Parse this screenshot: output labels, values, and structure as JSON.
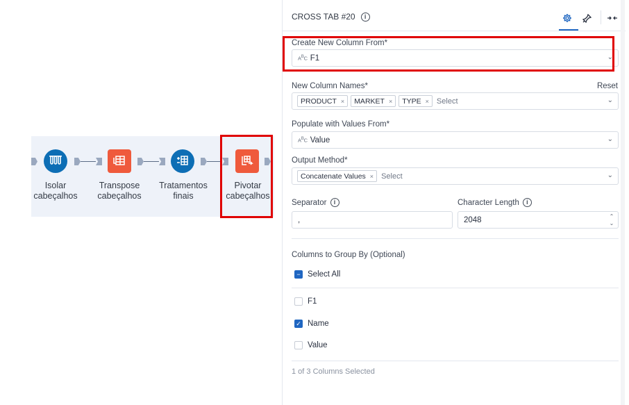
{
  "workflow": {
    "nodes": [
      {
        "label": "Isolar\ncabeçalhos",
        "icon": "test-tubes-icon",
        "shape": "circle",
        "color": "#0d6eb5"
      },
      {
        "label": "Transpose\ncabeçalhos",
        "icon": "transpose-icon",
        "shape": "square",
        "color": "#ef5a3c"
      },
      {
        "label": "Tratamentos\nfinais",
        "icon": "formula-icon",
        "shape": "circle",
        "color": "#0d6eb5"
      },
      {
        "label": "Pivotar\ncabeçalhos",
        "icon": "cross-tab-icon",
        "shape": "square",
        "color": "#ef5a3c"
      }
    ]
  },
  "panel": {
    "title": "CROSS TAB #20",
    "info_icon": "info-icon",
    "tabs": {
      "configuration": "gear-icon",
      "annotation": "pin-icon",
      "collapse": "collapse-panel-icon"
    }
  },
  "form": {
    "create_new_column": {
      "label": "Create New Column From*",
      "type_icon": "string-type-icon",
      "value": "F1"
    },
    "new_column_names": {
      "label": "New Column Names*",
      "reset": "Reset",
      "chips": [
        "PRODUCT",
        "MARKET",
        "TYPE"
      ],
      "placeholder": "Select"
    },
    "populate_values": {
      "label": "Populate with Values From*",
      "type_icon": "string-type-icon",
      "value": "Value"
    },
    "output_method": {
      "label": "Output Method*",
      "chips": [
        "Concatenate Values"
      ],
      "placeholder": "Select"
    },
    "separator": {
      "label": "Separator",
      "value": ","
    },
    "char_length": {
      "label": "Character Length",
      "value": "2048"
    },
    "group_by": {
      "label": "Columns to Group By (Optional)",
      "select_all": "Select All",
      "columns": [
        {
          "name": "F1",
          "checked": false
        },
        {
          "name": "Name",
          "checked": true
        },
        {
          "name": "Value",
          "checked": false
        }
      ],
      "footer": "1 of 3 Columns Selected"
    }
  },
  "colors": {
    "accent": "#1f66c1",
    "highlight": "#e00000",
    "node_blue": "#0d6eb5",
    "node_orange": "#ef5a3c"
  }
}
